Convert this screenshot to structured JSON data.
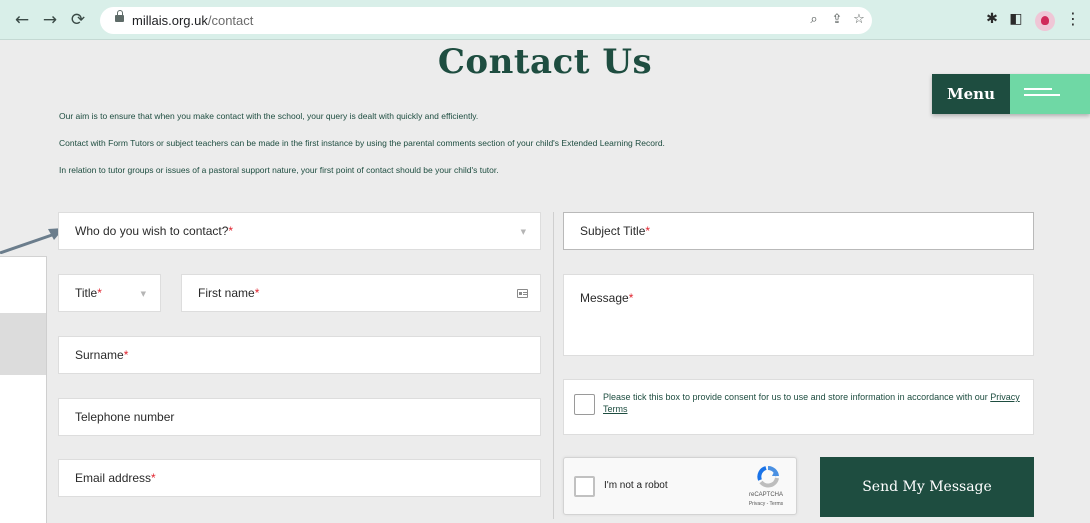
{
  "browser": {
    "url_host": "millais.org.uk",
    "url_path": "/contact",
    "back_icon": "←",
    "forward_icon": "→",
    "reload_icon": "⟳",
    "zoom_icon": "⌕",
    "share_icon": "⇪",
    "star_icon": "☆",
    "extensions_icon": "✱",
    "sidepanel_icon": "◧",
    "menu_icon": "⋮"
  },
  "page": {
    "title": "Contact Us",
    "menu_label": "Menu",
    "intro": [
      "Our aim is to ensure that when you make contact with the school, your query is dealt with quickly and efficiently.",
      "Contact with Form Tutors or subject teachers can be made in the first instance by using the parental comments section of your child's Extended Learning Record.",
      "In relation to tutor groups or issues of a pastoral support nature, your first point of contact should be your child's tutor."
    ]
  },
  "form": {
    "contact_label": "Who do you wish to contact?",
    "title_label": "Title",
    "first_name_label": "First name",
    "surname_label": "Surname",
    "telephone_label": "Telephone number",
    "email_label": "Email address",
    "subject_label": "Subject Title",
    "message_label": "Message",
    "required_mark": "*",
    "consent_text": "Please tick this box to provide consent for us to use and store information in accordance with our",
    "privacy_link": "Privacy Terms",
    "captcha_label": "I'm not a robot",
    "captcha_brand": "reCAPTCHA",
    "captcha_links": "Privacy - Terms",
    "submit_label": "Send My Message"
  },
  "colors": {
    "brand_dark_green": "#1e4d40",
    "accent_mint": "#6fd8a5",
    "required_red": "#e0242f",
    "chrome_bg": "#d9efe9"
  }
}
